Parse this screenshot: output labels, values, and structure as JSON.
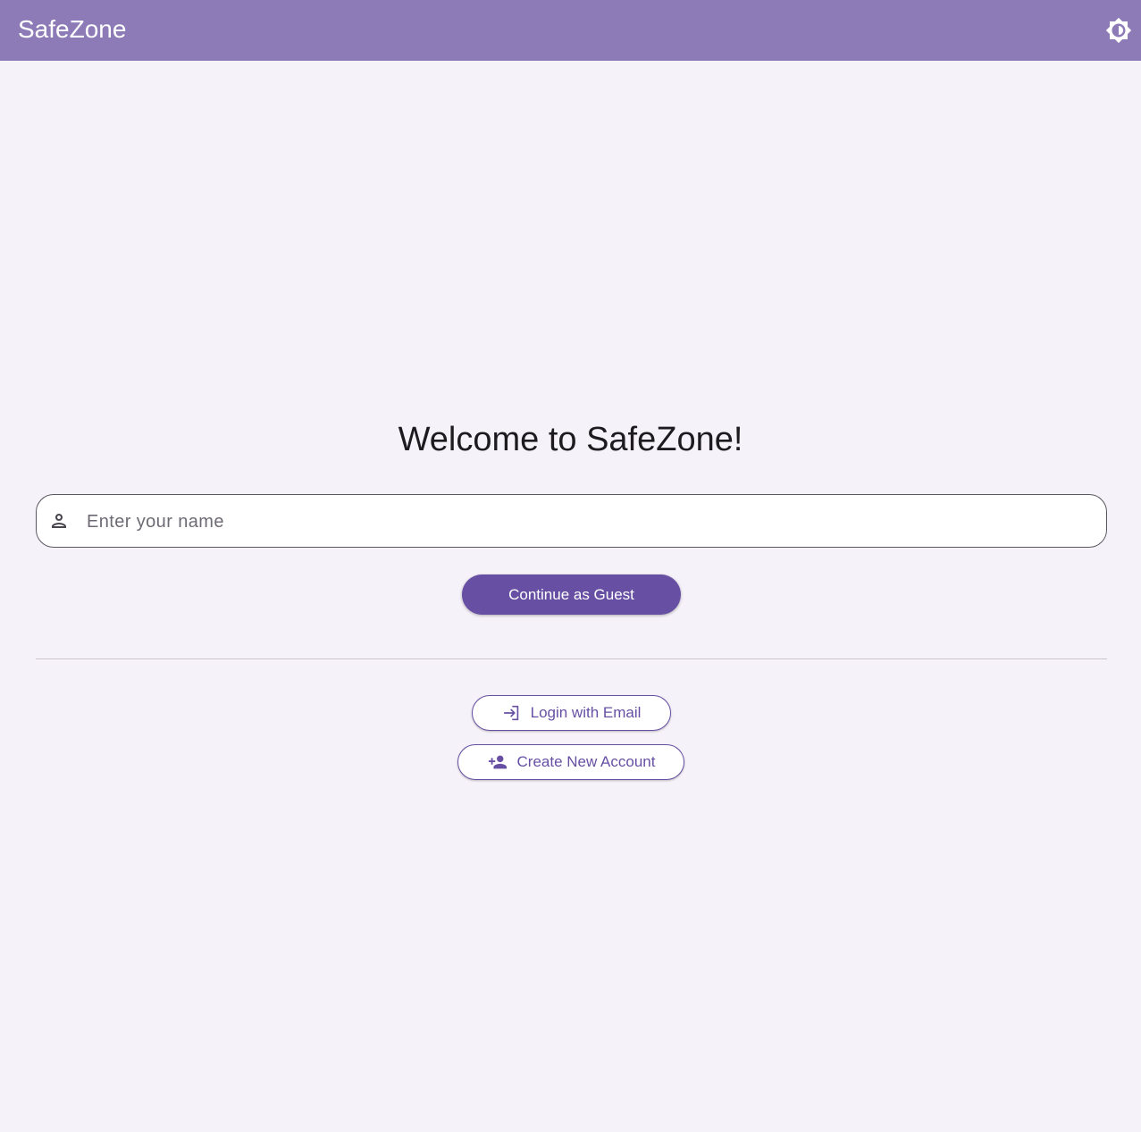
{
  "app_bar": {
    "title": "SafeZone",
    "theme_toggle_icon": "brightness-icon"
  },
  "main": {
    "welcome": "Welcome to SafeZone!",
    "name_field": {
      "placeholder": "Enter your name",
      "value": "",
      "icon": "person-icon"
    },
    "guest_button": "Continue as Guest",
    "login_button": {
      "label": "Login with Email",
      "icon": "login-icon"
    },
    "create_button": {
      "label": "Create New Account",
      "icon": "person-add-icon"
    }
  },
  "colors": {
    "app_bar": "#8d7bb7",
    "background": "#f6f2f9",
    "primary": "#6750a4"
  }
}
